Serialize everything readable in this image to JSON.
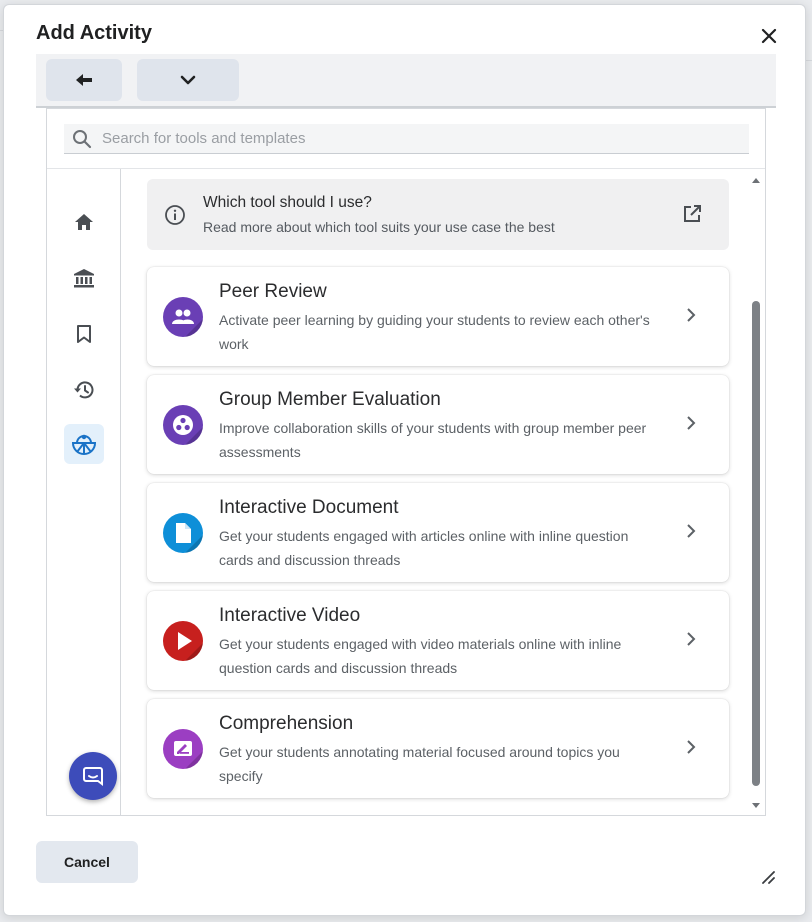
{
  "dialog": {
    "title": "Add Activity",
    "close_icon": "close-icon"
  },
  "toolbar": {
    "back_icon": "back-arrow-icon",
    "menu_icon": "chevron-down-icon"
  },
  "search": {
    "placeholder": "Search for tools and templates",
    "value": "",
    "icon": "search-icon"
  },
  "sidebar": {
    "items": [
      {
        "icon": "home-icon",
        "active": false
      },
      {
        "icon": "institution-icon",
        "active": false
      },
      {
        "icon": "bookmark-icon",
        "active": false
      },
      {
        "icon": "history-icon",
        "active": false
      },
      {
        "icon": "activity-category-icon",
        "active": true
      }
    ]
  },
  "info": {
    "title": "Which tool should I use?",
    "subtitle": "Read more about which tool suits your use case the best",
    "icon": "info-icon",
    "link_icon": "external-link-icon"
  },
  "tools": [
    {
      "title": "Peer Review",
      "description": "Activate peer learning by guiding your students to review each other's work",
      "icon": "peer-review-icon",
      "color": "#6a3fb5"
    },
    {
      "title": "Group Member Evaluation",
      "description": "Improve collaboration skills of your students with group member peer assessments",
      "icon": "group-evaluation-icon",
      "color": "#6a3fb5"
    },
    {
      "title": "Interactive Document",
      "description": "Get your students engaged with articles online with inline question cards and discussion threads",
      "icon": "document-icon",
      "color": "#0e8fd8"
    },
    {
      "title": "Interactive Video",
      "description": "Get your students engaged with video materials online with inline question cards and discussion threads",
      "icon": "video-play-icon",
      "color": "#c7201e"
    },
    {
      "title": "Comprehension",
      "description": "Get your students annotating material focused around topics you specify",
      "icon": "comprehension-icon",
      "color": "#9b3ec2"
    }
  ],
  "footer": {
    "cancel_label": "Cancel",
    "resize_icon": "resize-handle-icon"
  },
  "chat": {
    "icon": "chat-bubble-icon",
    "color": "#3d4cba"
  },
  "colors": {
    "accent": "#1a73c7",
    "active_nav_bg": "#e3f0fb"
  }
}
